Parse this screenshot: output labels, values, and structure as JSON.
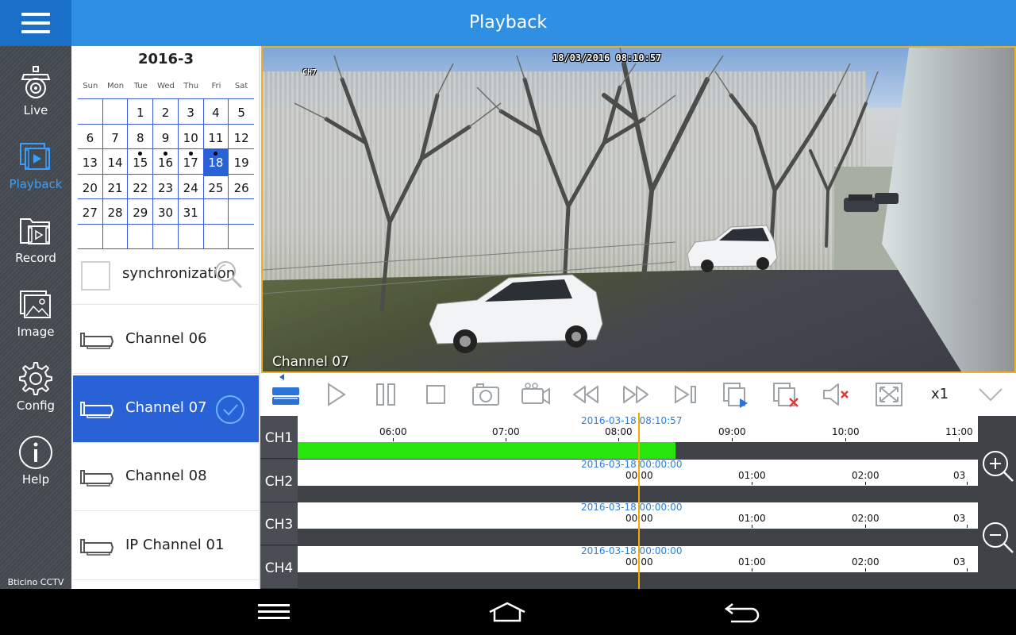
{
  "header": {
    "title": "Playback"
  },
  "nav": {
    "items": [
      {
        "label": "Live",
        "icon": "cctv-camera-icon"
      },
      {
        "label": "Playback",
        "icon": "video-film-icon",
        "active": true
      },
      {
        "label": "Record",
        "icon": "record-folder-icon"
      },
      {
        "label": "Image",
        "icon": "image-icon"
      },
      {
        "label": "Config",
        "icon": "gear-icon"
      },
      {
        "label": "Help",
        "icon": "info-icon"
      }
    ],
    "brand": "Bticino CCTV"
  },
  "calendar": {
    "title": "2016-3",
    "weekdays": [
      "Sun",
      "Mon",
      "Tue",
      "Wed",
      "Thu",
      "Fri",
      "Sat"
    ],
    "weeks": [
      [
        "",
        "",
        "1",
        "2",
        "3",
        "4",
        "5"
      ],
      [
        "6",
        "7",
        "8",
        "9",
        "10",
        "11",
        "12"
      ],
      [
        "13",
        "14",
        "15",
        "16",
        "17",
        "18",
        "19"
      ],
      [
        "20",
        "21",
        "22",
        "23",
        "24",
        "25",
        "26"
      ],
      [
        "27",
        "28",
        "29",
        "30",
        "31",
        "",
        ""
      ],
      [
        "",
        "",
        "",
        "",
        "",
        "",
        ""
      ]
    ],
    "recorded_days": [
      "15",
      "16",
      "17",
      "18"
    ],
    "selected_day": "18"
  },
  "sync": {
    "label": "synchronization"
  },
  "channels": [
    {
      "label": "Channel 06",
      "active": false
    },
    {
      "label": "Channel 07",
      "active": true
    },
    {
      "label": "Channel 08",
      "active": false
    },
    {
      "label": "IP Channel 01",
      "active": false
    }
  ],
  "video": {
    "osd_timestamp": "18/03/2016 08:10:57",
    "osd_channel": "CH7",
    "channel_label": "Channel 07"
  },
  "toolbar": {
    "speed": "x1",
    "buttons": [
      "record-list-icon",
      "play-icon",
      "pause-icon",
      "stop-icon",
      "snapshot-camera-icon",
      "record-video-icon",
      "rewind-icon",
      "fast-forward-icon",
      "next-frame-icon",
      "clip-copy-icon",
      "clip-delete-icon",
      "mute-icon",
      "fullscreen-icon",
      "chevron-down-icon"
    ]
  },
  "timeline": {
    "rows": [
      {
        "label": "CH1",
        "stamp": "2016-03-18 08:10:57",
        "ticks": [
          "06:00",
          "07:00",
          "08:00",
          "09:00",
          "10:00",
          "11:00"
        ],
        "recorded_fraction": 0.556
      },
      {
        "label": "CH2",
        "stamp": "2016-03-18 00:00:00",
        "ticks": [
          "00:00",
          "01:00",
          "02:00",
          "03"
        ],
        "recorded_fraction": 0
      },
      {
        "label": "CH3",
        "stamp": "2016-03-18 00:00:00",
        "ticks": [
          "00:00",
          "01:00",
          "02:00",
          "03"
        ],
        "recorded_fraction": 0
      },
      {
        "label": "CH4",
        "stamp": "2016-03-18 00:00:00",
        "ticks": [
          "00:00",
          "01:00",
          "02:00",
          "03"
        ],
        "recorded_fraction": 0
      }
    ]
  },
  "colors": {
    "topbar": "#2f8fe3",
    "accent": "#2962d6",
    "recorded": "#27e60b",
    "cursor": "#f2a900",
    "stamp": "#2b7fd9"
  }
}
